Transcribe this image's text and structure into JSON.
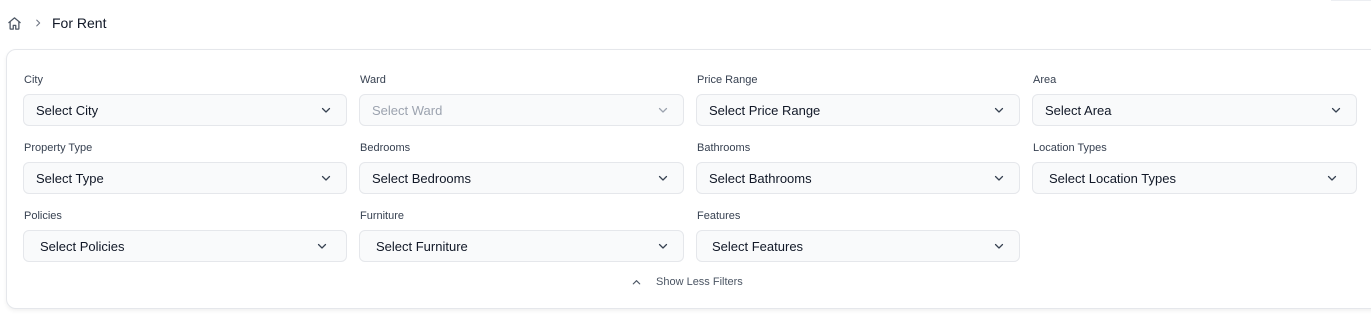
{
  "breadcrumb": {
    "home_icon": "home-icon",
    "separator_icon": "chevron-right-icon",
    "current": "For Rent"
  },
  "filters": {
    "city": {
      "label": "City",
      "value": "Select City"
    },
    "ward": {
      "label": "Ward",
      "value": "Select Ward",
      "disabled": true
    },
    "price_range": {
      "label": "Price Range",
      "value": "Select Price Range"
    },
    "area": {
      "label": "Area",
      "value": "Select Area"
    },
    "property_type": {
      "label": "Property Type",
      "value": "Select Type"
    },
    "bedrooms": {
      "label": "Bedrooms",
      "value": "Select Bedrooms"
    },
    "bathrooms": {
      "label": "Bathrooms",
      "value": "Select Bathrooms"
    },
    "location_types": {
      "label": "Location Types",
      "value": "Select Location Types"
    },
    "policies": {
      "label": "Policies",
      "value": "Select Policies"
    },
    "furniture": {
      "label": "Furniture",
      "value": "Select Furniture"
    },
    "features": {
      "label": "Features",
      "value": "Select Features"
    }
  },
  "toggle": {
    "label": "Show Less Filters",
    "icon": "chevron-up-icon"
  },
  "colors": {
    "text": "#111827",
    "label": "#374151",
    "muted": "#9ca3af",
    "border": "#e5e7eb",
    "field_bg": "#f9fafb"
  }
}
